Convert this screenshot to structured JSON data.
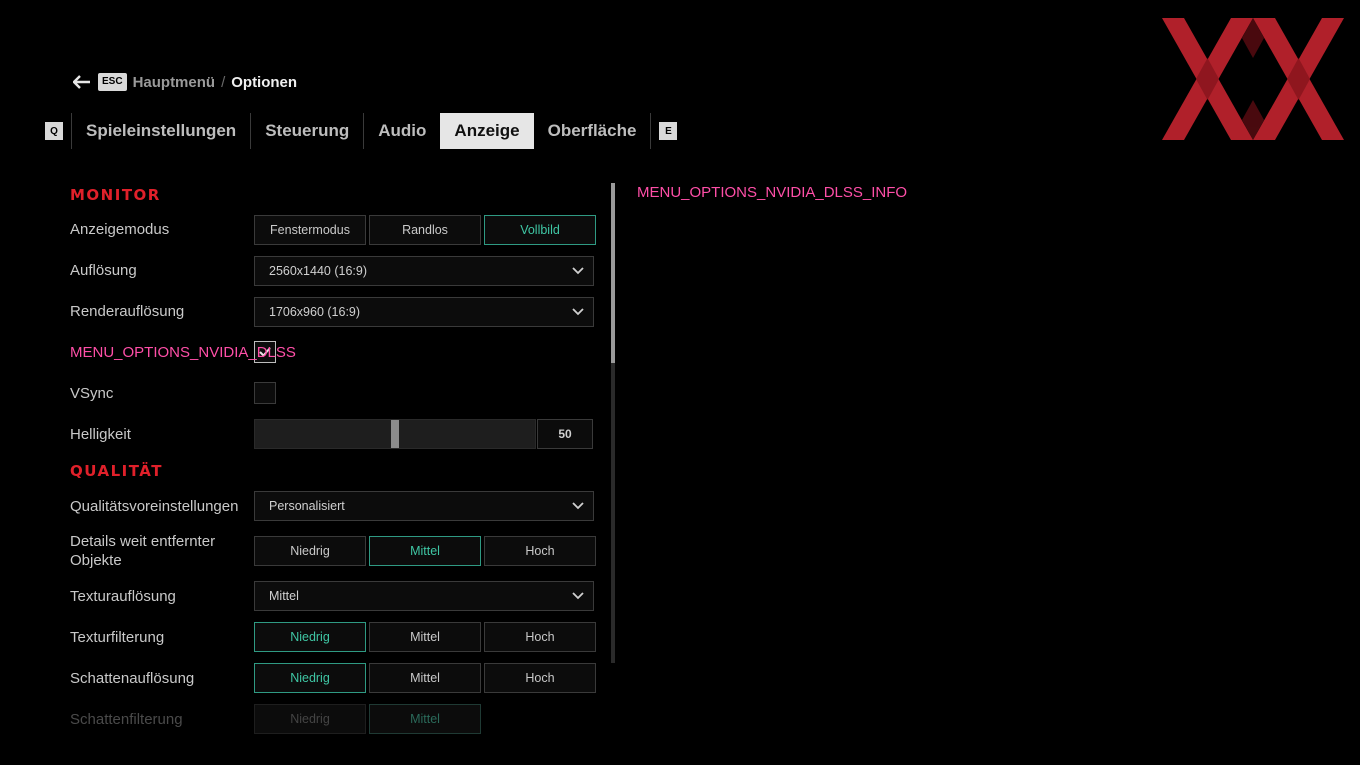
{
  "header": {
    "back_key": "ESC",
    "crumb_parent": "Hauptmenü",
    "crumb_separator": "/",
    "crumb_current": "Optionen"
  },
  "tabs": {
    "prev_key": "Q",
    "next_key": "E",
    "items": [
      {
        "label": "Spieleinstellungen",
        "active": false
      },
      {
        "label": "Steuerung",
        "active": false
      },
      {
        "label": "Audio",
        "active": false
      },
      {
        "label": "Anzeige",
        "active": true
      },
      {
        "label": "Oberfläche",
        "active": false
      }
    ]
  },
  "colors": {
    "accent_red": "#e0202a",
    "selected_teal": "#3fc6a4",
    "highlight_pink": "#ff4fa8",
    "logo_red": "#b0202a"
  },
  "sections": {
    "monitor": "MONITOR",
    "quality": "QUALITÄT"
  },
  "settings": {
    "display_mode": {
      "label": "Anzeigemodus",
      "options": [
        "Fenstermodus",
        "Randlos",
        "Vollbild"
      ],
      "selected": "Vollbild"
    },
    "resolution": {
      "label": "Auflösung",
      "value": "2560x1440 (16:9)"
    },
    "render_resolution": {
      "label": "Renderauflösung",
      "value": "1706x960 (16:9)"
    },
    "dlss": {
      "label": "MENU_OPTIONS_NVIDIA_DLSS",
      "checked": true
    },
    "vsync": {
      "label": "VSync",
      "checked": false
    },
    "brightness": {
      "label": "Helligkeit",
      "value": "50",
      "fraction": 0.5
    },
    "quality_preset": {
      "label": "Qualitätsvoreinstellungen",
      "value": "Personalisiert"
    },
    "far_detail": {
      "label_line1": "Details weit entfernter",
      "label_line2": "Objekte",
      "options": [
        "Niedrig",
        "Mittel",
        "Hoch"
      ],
      "selected": "Mittel"
    },
    "texture_resolution": {
      "label": "Texturauflösung",
      "value": "Mittel"
    },
    "texture_filtering": {
      "label": "Texturfilterung",
      "options": [
        "Niedrig",
        "Mittel",
        "Hoch"
      ],
      "selected": "Niedrig"
    },
    "shadow_resolution": {
      "label": "Schattenauflösung",
      "options": [
        "Niedrig",
        "Mittel",
        "Hoch"
      ],
      "selected": "Niedrig"
    },
    "shadow_filtering": {
      "label": "Schattenfilterung",
      "options": [
        "Niedrig",
        "Mittel"
      ],
      "selected": "Mittel"
    }
  },
  "info_panel": {
    "text": "MENU_OPTIONS_NVIDIA_DLSS_INFO"
  },
  "icons": {
    "back": "arrow-left-icon",
    "dropdown": "chevron-down-icon",
    "check": "checkmark-icon",
    "logo": "xx-logo"
  }
}
